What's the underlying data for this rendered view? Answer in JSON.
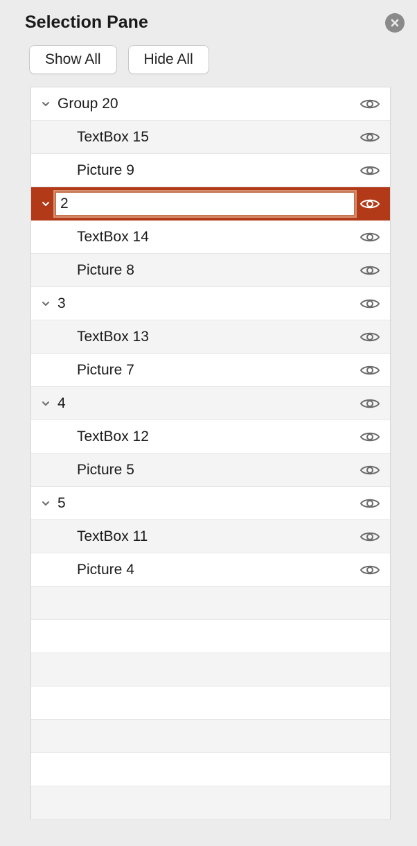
{
  "title": "Selection Pane",
  "buttons": {
    "show_all": "Show All",
    "hide_all": "Hide All"
  },
  "editing_value": "2",
  "items": [
    {
      "type": "group",
      "label": "Group 20",
      "depth": 0,
      "expanded": true,
      "visible": true,
      "selected": false,
      "editing": false
    },
    {
      "type": "item",
      "label": "TextBox 15",
      "depth": 1,
      "visible": true,
      "selected": false,
      "editing": false
    },
    {
      "type": "item",
      "label": "Picture 9",
      "depth": 1,
      "visible": true,
      "selected": false,
      "editing": false
    },
    {
      "type": "group",
      "label": "2",
      "depth": 0,
      "expanded": true,
      "visible": true,
      "selected": true,
      "editing": true
    },
    {
      "type": "item",
      "label": "TextBox 14",
      "depth": 1,
      "visible": true,
      "selected": false,
      "editing": false
    },
    {
      "type": "item",
      "label": "Picture 8",
      "depth": 1,
      "visible": true,
      "selected": false,
      "editing": false
    },
    {
      "type": "group",
      "label": "3",
      "depth": 0,
      "expanded": true,
      "visible": true,
      "selected": false,
      "editing": false
    },
    {
      "type": "item",
      "label": "TextBox 13",
      "depth": 1,
      "visible": true,
      "selected": false,
      "editing": false
    },
    {
      "type": "item",
      "label": "Picture 7",
      "depth": 1,
      "visible": true,
      "selected": false,
      "editing": false
    },
    {
      "type": "group",
      "label": "4",
      "depth": 0,
      "expanded": true,
      "visible": true,
      "selected": false,
      "editing": false
    },
    {
      "type": "item",
      "label": "TextBox 12",
      "depth": 1,
      "visible": true,
      "selected": false,
      "editing": false
    },
    {
      "type": "item",
      "label": "Picture 5",
      "depth": 1,
      "visible": true,
      "selected": false,
      "editing": false
    },
    {
      "type": "group",
      "label": "5",
      "depth": 0,
      "expanded": true,
      "visible": true,
      "selected": false,
      "editing": false
    },
    {
      "type": "item",
      "label": "TextBox 11",
      "depth": 1,
      "visible": true,
      "selected": false,
      "editing": false
    },
    {
      "type": "item",
      "label": "Picture 4",
      "depth": 1,
      "visible": true,
      "selected": false,
      "editing": false
    }
  ],
  "empty_rows": 7,
  "colors": {
    "selection": "#b23a19"
  }
}
